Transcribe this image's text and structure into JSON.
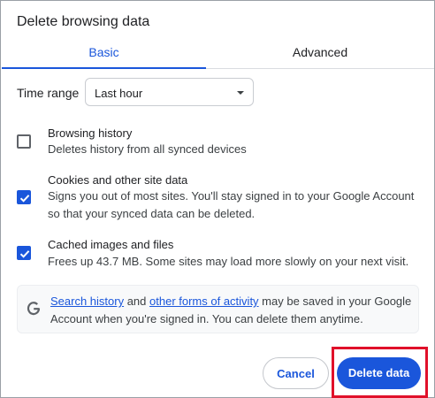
{
  "dialog": {
    "title": "Delete browsing data"
  },
  "tabs": [
    {
      "label": "Basic",
      "selected": true
    },
    {
      "label": "Advanced",
      "selected": false
    }
  ],
  "time_range": {
    "label": "Time range",
    "value": "Last hour"
  },
  "options": [
    {
      "title": "Browsing history",
      "description": "Deletes history from all synced devices",
      "checked": false
    },
    {
      "title": "Cookies and other site data",
      "description": "Signs you out of most sites. You'll stay signed in to your Google Account so that your synced data can be deleted.",
      "checked": true
    },
    {
      "title": "Cached images and files",
      "description": "Frees up 43.7 MB. Some sites may load more slowly on your next visit.",
      "checked": true
    }
  ],
  "info": {
    "icon": "google-g-icon",
    "link1": "Search history",
    "text1": " and ",
    "link2": "other forms of activity",
    "text2": " may be saved in your Google Account when you're signed in. You can delete them anytime."
  },
  "buttons": {
    "cancel": "Cancel",
    "delete": "Delete data"
  },
  "colors": {
    "accent": "#1a56db",
    "highlight": "#e0102a"
  }
}
